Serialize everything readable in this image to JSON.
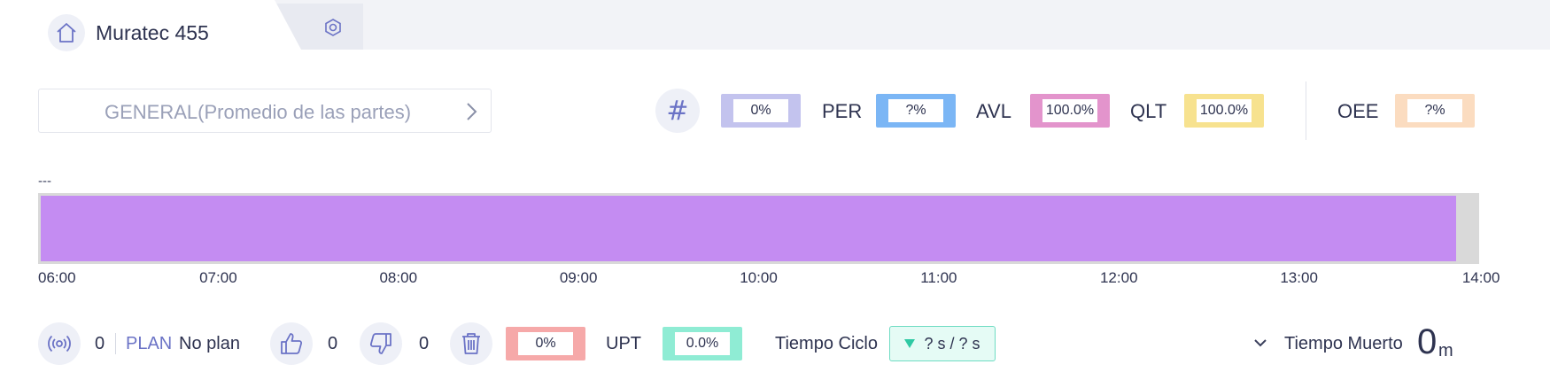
{
  "tabs": {
    "active_title": "Muratec 455",
    "home_icon": "home-icon",
    "second_tab_icon": "settings-icon"
  },
  "selector": {
    "label": "GENERAL(Promedio de las partes)",
    "arrow_icon": "chevron-right-icon"
  },
  "kpis": {
    "hash_symbol": "#",
    "count_value": "0%",
    "per_label": "PER",
    "per_value": "?%",
    "avl_label": "AVL",
    "avl_value": "100.0%",
    "qlt_label": "QLT",
    "qlt_value": "100.0%",
    "oee_label": "OEE",
    "oee_value": "?%",
    "colors": {
      "count": "#c3c3ee",
      "per": "#7bb6f5",
      "avl": "#e394cc",
      "qlt": "#f7e28f",
      "oee": "#fbdcc0"
    }
  },
  "timeline": {
    "label": "---",
    "bar_color": "#c48cf2",
    "track_color": "#d9d9d9",
    "range_start_hour": 6,
    "range_end_hour": 14,
    "bar_start_hour": 6,
    "bar_end_hour": 13.87,
    "ticks": [
      "06:00",
      "07:00",
      "08:00",
      "09:00",
      "10:00",
      "11:00",
      "12:00",
      "13:00",
      "14:00"
    ]
  },
  "bottom": {
    "signal_icon": "signal-icon",
    "signal_count": "0",
    "plan_label": "PLAN",
    "plan_value": "No plan",
    "thumbs_up_icon": "thumbs-up-icon",
    "good_count": "0",
    "thumbs_down_icon": "thumbs-down-icon",
    "bad_count": "0",
    "trash_icon": "trash-icon",
    "scrap_value": "0%",
    "upt_label": "UPT",
    "upt_value": "0.0%",
    "cycle_label": "Tiempo Ciclo",
    "cycle_value": "? s / ? s",
    "dead_label": "Tiempo Muerto",
    "dead_value": "0",
    "dead_unit": "m",
    "colors": {
      "scrap": "#f6a9a9",
      "upt": "#8fecd4"
    }
  }
}
